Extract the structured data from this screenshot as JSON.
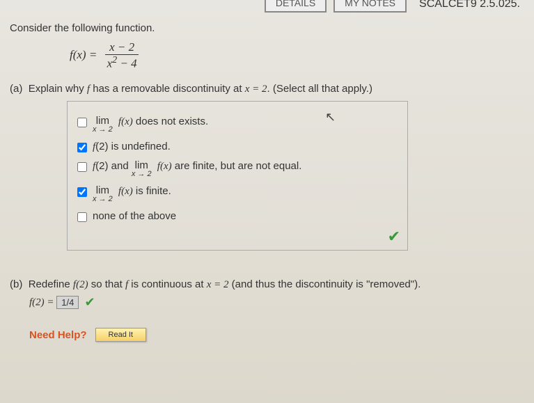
{
  "header": {
    "details_btn": "DETAILS",
    "notes_btn": "MY NOTES",
    "ref": "SCALCET9 2.5.025."
  },
  "prompt": "Consider the following function.",
  "equation": {
    "lhs": "f(x) =",
    "num": "x − 2",
    "den_pre": "x",
    "den_exp": "2",
    "den_post": " − 4"
  },
  "part_a": {
    "label": "(a)",
    "text_pre": "Explain why ",
    "fsym": "f",
    "text_mid": " has a removable discontinuity at ",
    "eqtxt": "x = 2",
    "text_post": ". (Select all that apply.)",
    "opts": [
      {
        "checked": false,
        "kind": "lim",
        "lim_sub": "x → 2",
        "tail": " does not exists."
      },
      {
        "checked": true,
        "kind": "plain",
        "text": "f(2) is undefined."
      },
      {
        "checked": false,
        "kind": "mixed",
        "pre": "f(2) and ",
        "lim_sub": "x → 2",
        "tail": " are finite, but are not equal."
      },
      {
        "checked": true,
        "kind": "lim",
        "lim_sub": "x → 2",
        "tail": " is finite."
      },
      {
        "checked": false,
        "kind": "plain",
        "text": "none of the above"
      }
    ]
  },
  "part_b": {
    "label": "(b)",
    "text_pre": "Redefine ",
    "fof2": "f(2)",
    "text_mid": " so that ",
    "fsym": "f",
    "text_mid2": " is continuous at ",
    "eqtxt": "x = 2",
    "text_post": " (and thus the discontinuity is \"removed\").",
    "answer_lhs": "f(2) = ",
    "answer_val": "1/4"
  },
  "help": {
    "label": "Need Help?",
    "readit": "Read It"
  }
}
